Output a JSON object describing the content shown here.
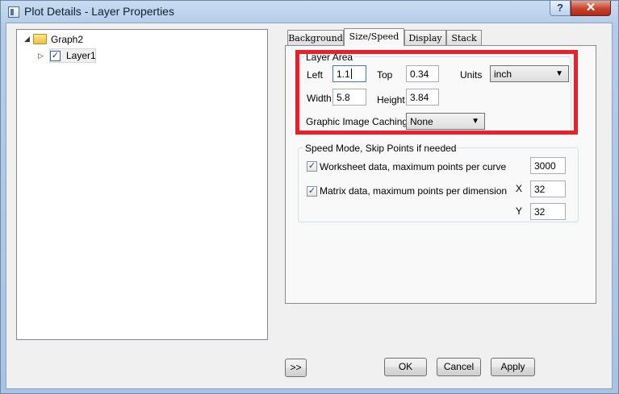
{
  "window": {
    "title": "Plot Details - Layer Properties",
    "help_label": "?",
    "close_label": "✕"
  },
  "tree": {
    "root": {
      "label": "Graph2",
      "expander": "◢"
    },
    "child": {
      "label": "Layer1",
      "expander": "▷",
      "checked": true
    }
  },
  "tabs": [
    {
      "label": "Background"
    },
    {
      "label": "Size/Speed"
    },
    {
      "label": "Display"
    },
    {
      "label": "Stack"
    }
  ],
  "layer_area": {
    "legend": "Layer Area",
    "left_label": "Left",
    "left_value": "1.1",
    "top_label": "Top",
    "top_value": "0.34",
    "units_label": "Units",
    "units_value": "inch",
    "width_label": "Width",
    "width_value": "5.8",
    "height_label": "Height",
    "height_value": "3.84",
    "caching_label": "Graphic Image Caching",
    "caching_value": "None"
  },
  "speed_mode": {
    "legend": "Speed Mode, Skip Points if needed",
    "worksheet_label": "Worksheet data, maximum points per curve",
    "worksheet_value": "3000",
    "worksheet_checked": true,
    "matrix_label": "Matrix data, maximum points per dimension",
    "matrix_checked": true,
    "x_label": "X",
    "x_value": "32",
    "y_label": "Y",
    "y_value": "32"
  },
  "buttons": {
    "more": ">>",
    "ok": "OK",
    "cancel": "Cancel",
    "apply": "Apply"
  },
  "icons": {
    "check": "✓",
    "dropdown": "▼"
  },
  "colors": {
    "highlight": "#e8202a",
    "close": "#c4422b"
  }
}
